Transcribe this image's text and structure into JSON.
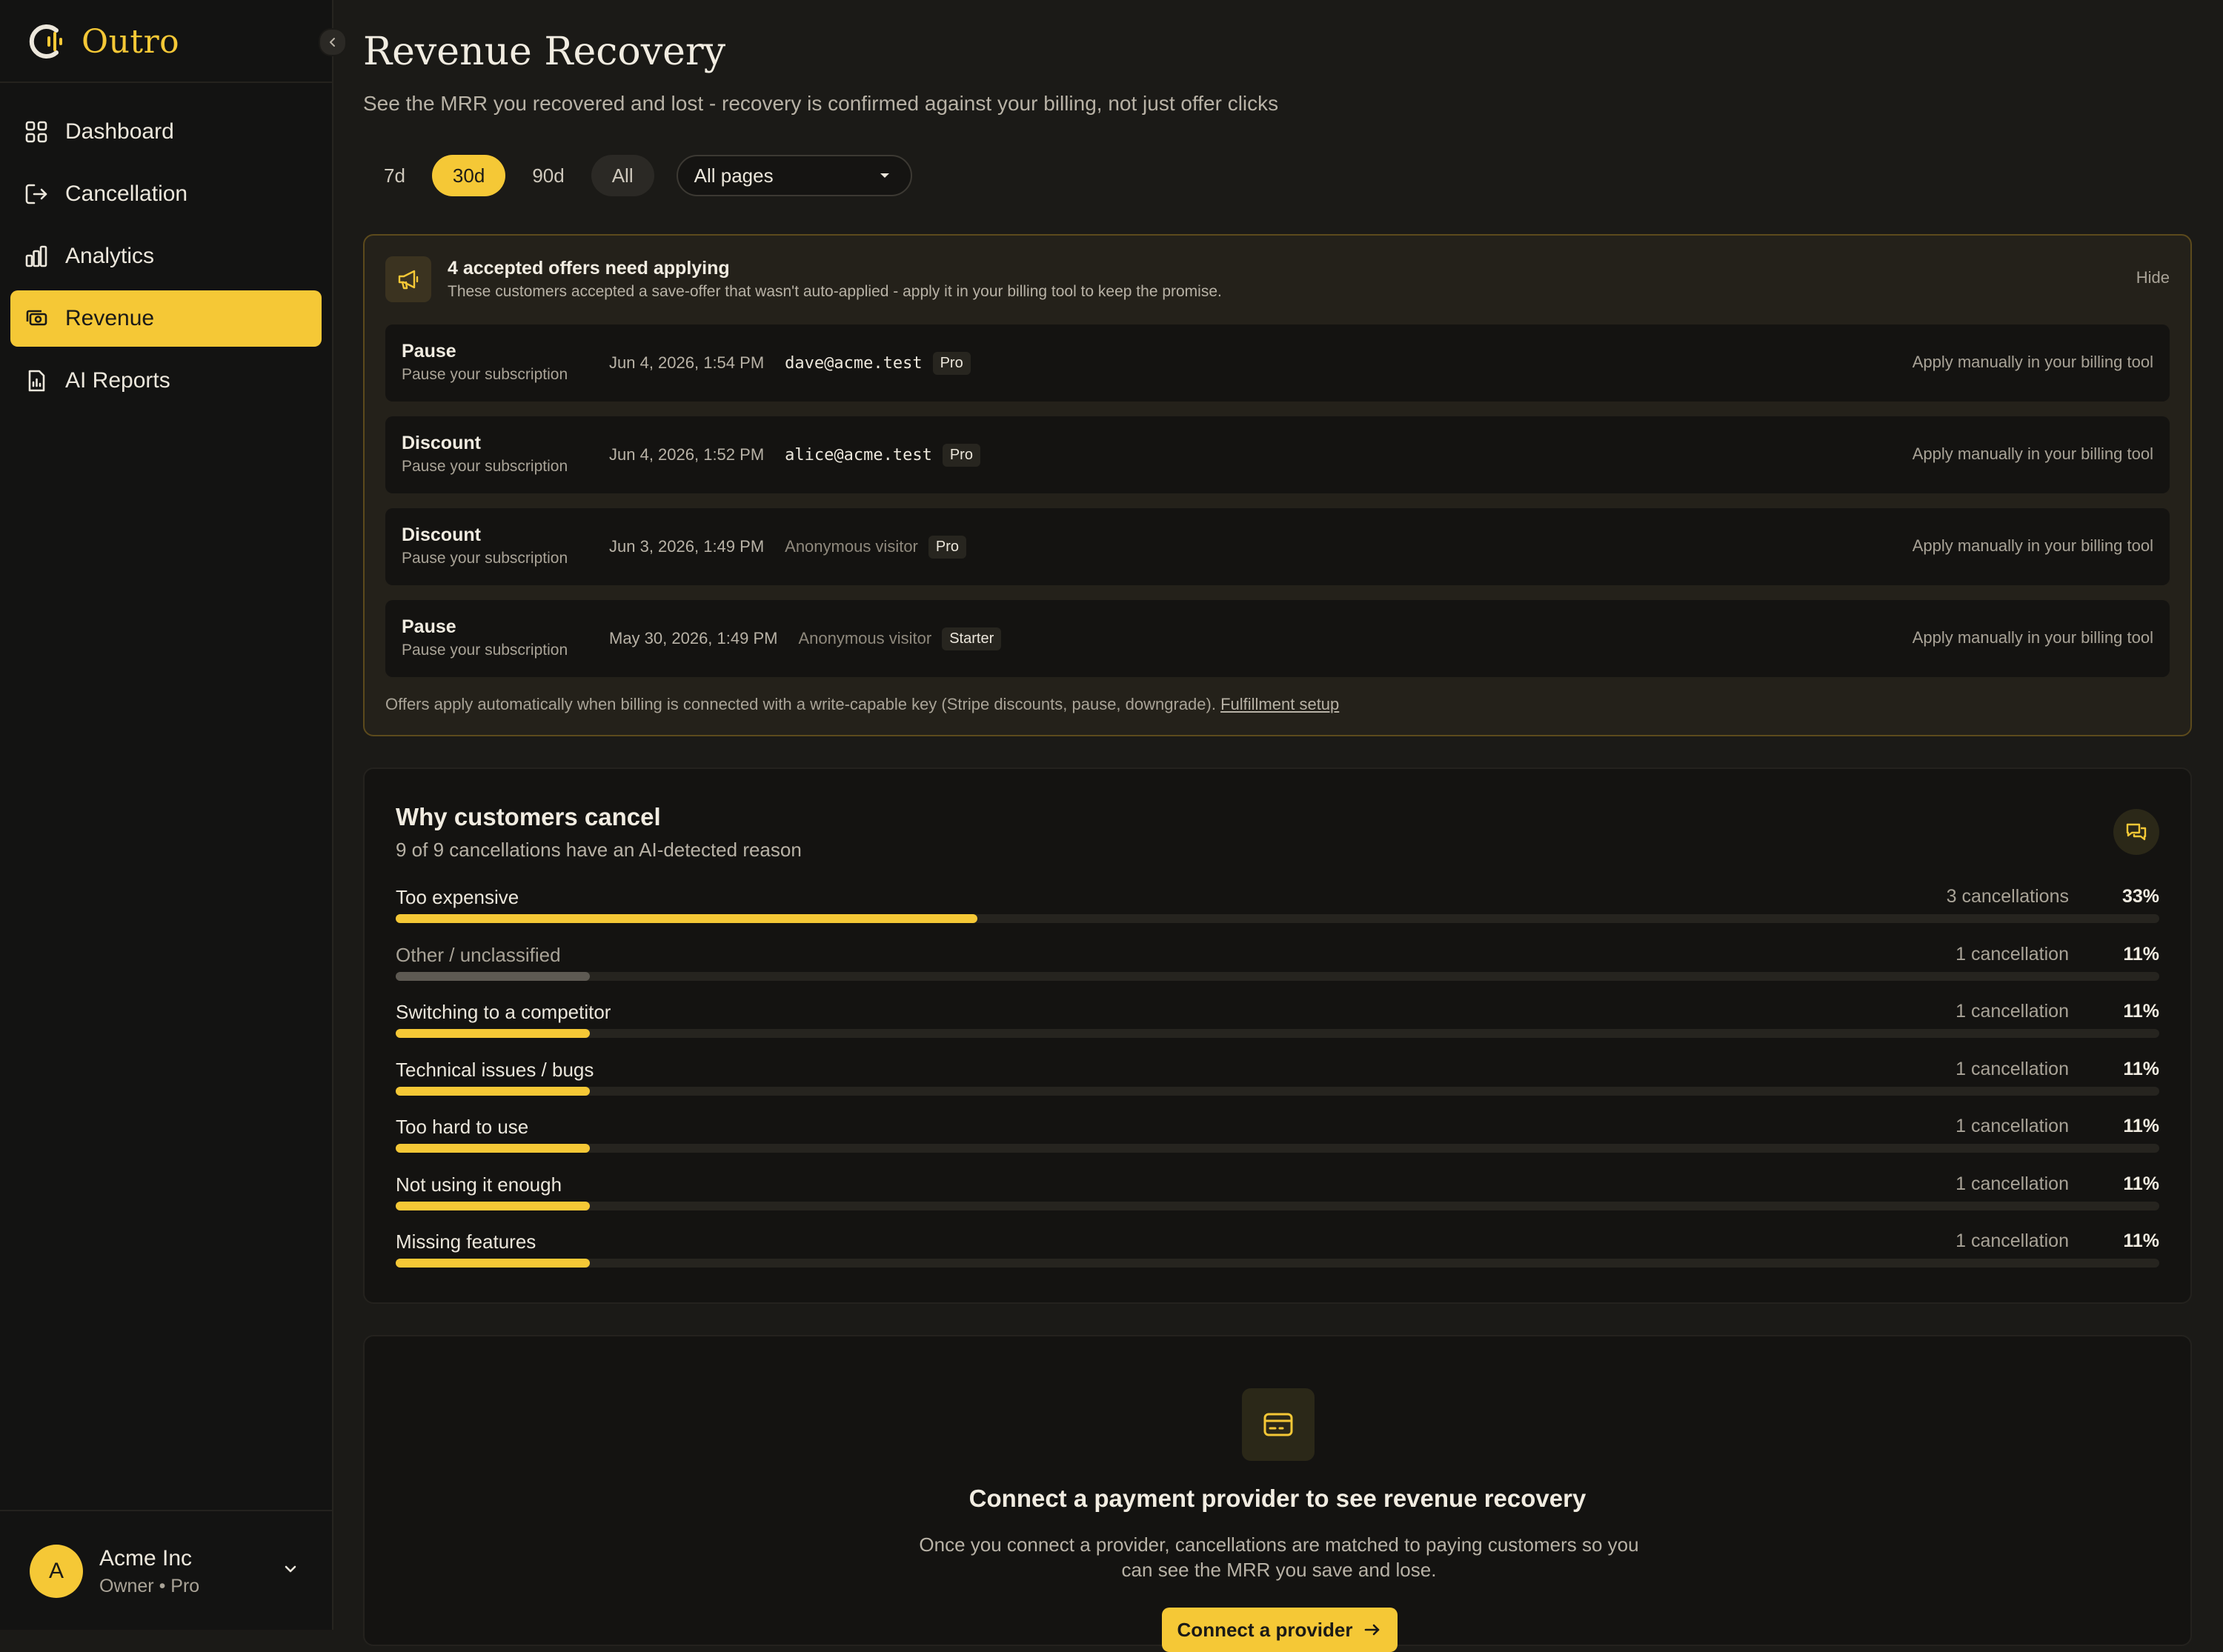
{
  "brand": {
    "name": "Outro"
  },
  "sidebar": {
    "items": [
      {
        "label": "Dashboard",
        "icon": "dashboard-grid-icon"
      },
      {
        "label": "Cancellation",
        "icon": "exit-icon"
      },
      {
        "label": "Analytics",
        "icon": "bar-chart-icon"
      },
      {
        "label": "Revenue",
        "icon": "money-icon",
        "active": true
      },
      {
        "label": "AI Reports",
        "icon": "report-icon"
      }
    ],
    "user": {
      "initial": "A",
      "name": "Acme Inc",
      "role": "Owner • Pro"
    }
  },
  "page": {
    "title": "Revenue Recovery",
    "subtitle": "See the MRR you recovered and lost - recovery is confirmed against your billing, not just offer clicks"
  },
  "filters": {
    "ranges": [
      "7d",
      "30d",
      "90d",
      "All"
    ],
    "selected_range": "30d",
    "pages_select": "All pages"
  },
  "offers": {
    "title": "4 accepted offers need applying",
    "subtitle": "These customers accepted a save-offer that wasn't auto-applied - apply it in your billing tool to keep the promise.",
    "hide_label": "Hide",
    "rows": [
      {
        "type": "Pause",
        "desc": "Pause your subscription",
        "date": "Jun 4, 2026, 1:54 PM",
        "customer": "dave@acme.test",
        "anonymous": false,
        "plan": "Pro",
        "action": "Apply manually in your billing tool"
      },
      {
        "type": "Discount",
        "desc": "Pause your subscription",
        "date": "Jun 4, 2026, 1:52 PM",
        "customer": "alice@acme.test",
        "anonymous": false,
        "plan": "Pro",
        "action": "Apply manually in your billing tool"
      },
      {
        "type": "Discount",
        "desc": "Pause your subscription",
        "date": "Jun 3, 2026, 1:49 PM",
        "customer": "Anonymous visitor",
        "anonymous": true,
        "plan": "Pro",
        "action": "Apply manually in your billing tool"
      },
      {
        "type": "Pause",
        "desc": "Pause your subscription",
        "date": "May 30, 2026, 1:49 PM",
        "customer": "Anonymous visitor",
        "anonymous": true,
        "plan": "Starter",
        "action": "Apply manually in your billing tool"
      }
    ],
    "footer_text": "Offers apply automatically when billing is connected with a write-capable key (Stripe discounts, pause, downgrade).",
    "footer_link": "Fulfillment setup"
  },
  "reasons": {
    "title": "Why customers cancel",
    "subtitle": "9 of 9 cancellations have an AI-detected reason",
    "items": [
      {
        "label": "Too expensive",
        "count": "3 cancellations",
        "pct": "33%",
        "value": 0.33,
        "muted": false
      },
      {
        "label": "Other / unclassified",
        "count": "1 cancellation",
        "pct": "11%",
        "value": 0.11,
        "muted": true
      },
      {
        "label": "Switching to a competitor",
        "count": "1 cancellation",
        "pct": "11%",
        "value": 0.11,
        "muted": false
      },
      {
        "label": "Technical issues / bugs",
        "count": "1 cancellation",
        "pct": "11%",
        "value": 0.11,
        "muted": false
      },
      {
        "label": "Too hard to use",
        "count": "1 cancellation",
        "pct": "11%",
        "value": 0.11,
        "muted": false
      },
      {
        "label": "Not using it enough",
        "count": "1 cancellation",
        "pct": "11%",
        "value": 0.11,
        "muted": false
      },
      {
        "label": "Missing features",
        "count": "1 cancellation",
        "pct": "11%",
        "value": 0.11,
        "muted": false
      }
    ]
  },
  "connect": {
    "title": "Connect a payment provider to see revenue recovery",
    "text": "Once you connect a provider, cancellations are matched to paying customers so you can see the MRR you save and lose.",
    "button": "Connect a provider"
  },
  "colors": {
    "accent": "#f5c836",
    "background": "#1b1a17",
    "sidebar": "#131312",
    "panel": "#141311",
    "alert_border": "#5c4a1c"
  }
}
